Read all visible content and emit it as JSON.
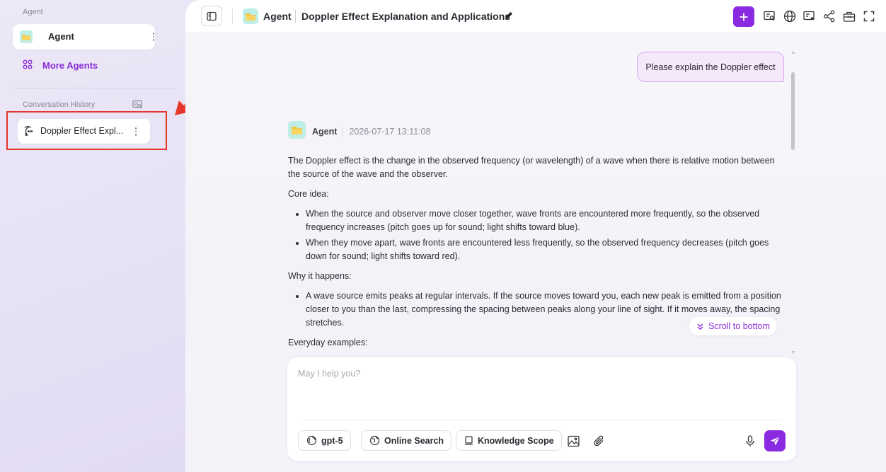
{
  "sidebar": {
    "agent_section_label": "Agent",
    "agent_name": "Agent",
    "more_agents_label": "More Agents",
    "history_label": "Conversation History",
    "conversations": [
      {
        "title": "Doppler Effect Expl..."
      }
    ]
  },
  "topbar": {
    "agent_label": "Agent",
    "conversation_title": "Doppler Effect Explanation and Applications"
  },
  "conversation": {
    "user_message": "Please explain the Doppler effect",
    "agent_name": "Agent",
    "timestamp": "2026-07-17 13:11:08",
    "intro": "The Doppler effect is the change in the observed frequency (or wavelength) of a wave when there is relative motion between the source of the wave and the observer.",
    "core_idea_heading": "Core idea:",
    "core_idea_points": [
      "When the source and observer move closer together, wave fronts are encountered more frequently, so the observed frequency increases (pitch goes up for sound; light shifts toward blue).",
      "When they move apart, wave fronts are encountered less frequently, so the observed frequency decreases (pitch goes down for sound; light shifts toward red)."
    ],
    "why_heading": "Why it happens:",
    "why_points": [
      "A wave source emits peaks at regular intervals. If the source moves toward you, each new peak is emitted from a position closer to you than the last, compressing the spacing between peaks along your line of sight. If it moves away, the spacing stretches."
    ],
    "examples_heading": "Everyday examples:",
    "scroll_to_bottom_label": "Scroll to bottom"
  },
  "composer": {
    "placeholder": "May I help you?",
    "model_label": "gpt-5",
    "online_search_label": "Online Search",
    "knowledge_scope_label": "Knowledge Scope"
  },
  "colors": {
    "accent": "#8a2be2",
    "annotation_red": "#e5362c"
  }
}
